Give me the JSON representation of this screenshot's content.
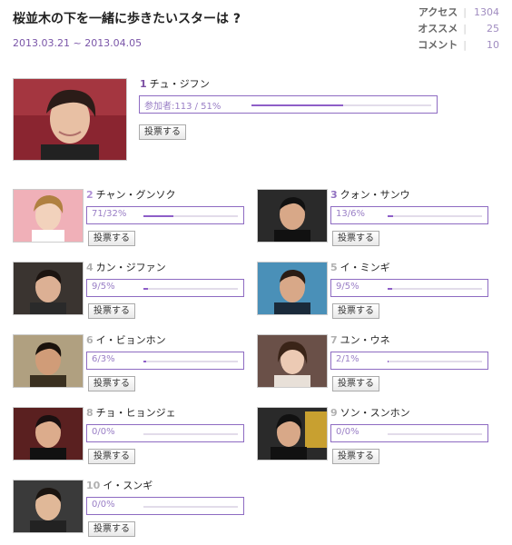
{
  "poll": {
    "title": "桜並木の下を一緒に歩きたいスターは ?",
    "date_range": "2013.03.21 ~ 2013.04.05",
    "stats": [
      {
        "label": "アクセス",
        "value": "1304"
      },
      {
        "label": "オススメ",
        "value": "25"
      },
      {
        "label": "コメント",
        "value": "10"
      }
    ],
    "vote_label": "投票する"
  },
  "candidates": [
    {
      "rank": "1",
      "name": "チュ・ジフン",
      "result": "参加者:113 / 51%",
      "share": 0.51
    },
    {
      "rank": "2",
      "name": "チャン・グンソク",
      "result": "71/32%",
      "share": 0.32
    },
    {
      "rank": "3",
      "name": "クォン・サンウ",
      "result": "13/6%",
      "share": 0.06
    },
    {
      "rank": "4",
      "name": "カン・ジファン",
      "result": "9/5%",
      "share": 0.05
    },
    {
      "rank": "5",
      "name": "イ・ミンギ",
      "result": "9/5%",
      "share": 0.05
    },
    {
      "rank": "6",
      "name": "イ・ビョンホン",
      "result": "6/3%",
      "share": 0.03
    },
    {
      "rank": "7",
      "name": "ユン・ウネ",
      "result": "2/1%",
      "share": 0.01
    },
    {
      "rank": "8",
      "name": "チョ・ヒョンジェ",
      "result": "0/0%",
      "share": 0
    },
    {
      "rank": "9",
      "name": "ソン・スンホン",
      "result": "0/0%",
      "share": 0
    },
    {
      "rank": "10",
      "name": "イ・スンギ",
      "result": "0/0%",
      "share": 0
    }
  ]
}
